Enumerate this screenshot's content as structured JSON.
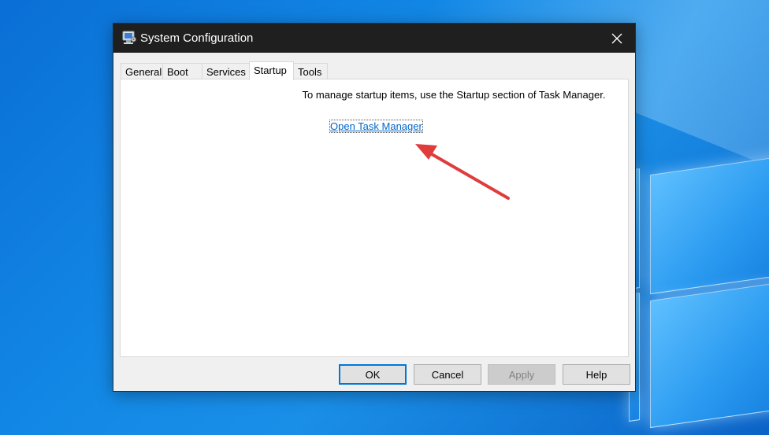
{
  "window": {
    "title": "System Configuration",
    "close_icon": "close-icon",
    "app_icon": "msconfig-icon"
  },
  "tabs": [
    {
      "label": "General"
    },
    {
      "label": "Boot"
    },
    {
      "label": "Services"
    },
    {
      "label": "Startup",
      "active": true
    },
    {
      "label": "Tools"
    }
  ],
  "startup": {
    "message": "To manage startup items, use the Startup section of Task Manager.",
    "link_label": "Open Task Manager"
  },
  "buttons": {
    "ok": "OK",
    "cancel": "Cancel",
    "apply": "Apply",
    "help": "Help"
  },
  "colors": {
    "accent": "#0078d7",
    "link": "#0066cc",
    "annotation_arrow": "#e03c3c",
    "titlebar": "#1f1f1f"
  }
}
